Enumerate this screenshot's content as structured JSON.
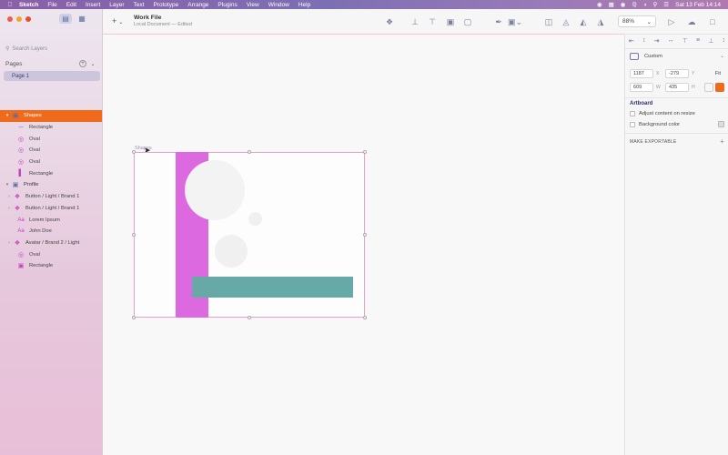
{
  "menubar": {
    "app_name": "Sketch",
    "items": [
      "File",
      "Edit",
      "Insert",
      "Layer",
      "Text",
      "Prototype",
      "Arrange",
      "Plugins",
      "View",
      "Window",
      "Help"
    ],
    "clock": "Sat 13 Feb 14:14"
  },
  "sidebar": {
    "search_placeholder": "Search Layers",
    "pages_label": "Pages",
    "pages": [
      "Page 1"
    ],
    "layers": [
      {
        "name": "Shapes",
        "kind": "artboard",
        "selected": true
      },
      {
        "name": "Rectangle",
        "kind": "line"
      },
      {
        "name": "Oval",
        "kind": "oval"
      },
      {
        "name": "Oval",
        "kind": "oval"
      },
      {
        "name": "Oval",
        "kind": "oval"
      },
      {
        "name": "Rectangle",
        "kind": "rect"
      },
      {
        "name": "Profile",
        "kind": "artboard"
      },
      {
        "name": "Button / Light / Brand 1",
        "kind": "symbol"
      },
      {
        "name": "Button / Light / Brand 1",
        "kind": "symbol"
      },
      {
        "name": "Lorem Ipsum",
        "kind": "text"
      },
      {
        "name": "John Doe",
        "kind": "text"
      },
      {
        "name": "Avatar / Brand 2 / Light",
        "kind": "symbol"
      },
      {
        "name": "Oval",
        "kind": "oval"
      },
      {
        "name": "Rectangle",
        "kind": "rect"
      }
    ]
  },
  "toolbar": {
    "insert_icon": "+",
    "doc_title": "Work File",
    "doc_subtitle": "Local Document — Edited",
    "zoom": "88%"
  },
  "canvas": {
    "artboard_label": "Shapes",
    "colors": {
      "pink": "#dc69df",
      "teal": "#67a9a6"
    }
  },
  "inspector": {
    "preset": "Custom",
    "x": "1187",
    "y": "-279",
    "w": "609",
    "h": "435",
    "x_label": "X",
    "y_label": "Y",
    "w_label": "W",
    "h_label": "H",
    "fit": "Fit",
    "artboard_title": "Artboard",
    "adjust_label": "Adjust content on resize",
    "bg_label": "Background color",
    "export_label": "MAKE EXPORTABLE"
  }
}
